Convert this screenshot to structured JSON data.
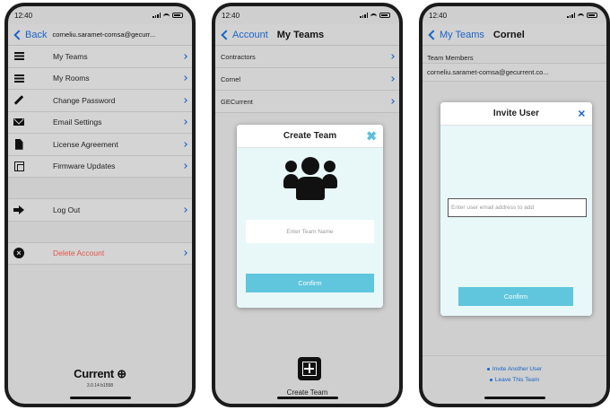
{
  "status_time": "12:40",
  "colors": {
    "accent": "#1a64c8",
    "teal": "#5fc6dd",
    "danger": "#e0584a"
  },
  "screen1": {
    "back_label": "Back",
    "email": "corneliu.saramet-comsa@gecurr...",
    "menu": [
      {
        "label": "My Teams",
        "icon": "list-icon"
      },
      {
        "label": "My Rooms",
        "icon": "list-icon"
      },
      {
        "label": "Change Password",
        "icon": "pencil-icon"
      },
      {
        "label": "Email Settings",
        "icon": "envelope-icon"
      },
      {
        "label": "License Agreement",
        "icon": "document-icon"
      },
      {
        "label": "Firmware Updates",
        "icon": "copy-icon"
      }
    ],
    "logout_label": "Log Out",
    "delete_label": "Delete Account",
    "brand": "Current",
    "version": "3.0.14 b1558"
  },
  "screen2": {
    "back_label": "Account",
    "title": "My Teams",
    "teams": [
      "Contractors",
      "Cornel",
      "GECurrent"
    ],
    "modal_title": "Create Team",
    "team_name_placeholder": "Enter Team Name",
    "confirm_label": "Confirm",
    "create_team_label": "Create Team"
  },
  "screen3": {
    "back_label": "My Teams",
    "title": "Cornel",
    "section_label": "Team Members",
    "member_email": "corneliu.saramet-comsa@gecurrent.co...",
    "modal_title": "Invite User",
    "email_placeholder": "Enter user email address to add",
    "confirm_label": "Confirm",
    "links": [
      "Invite Another User",
      "Leave This Team"
    ]
  }
}
